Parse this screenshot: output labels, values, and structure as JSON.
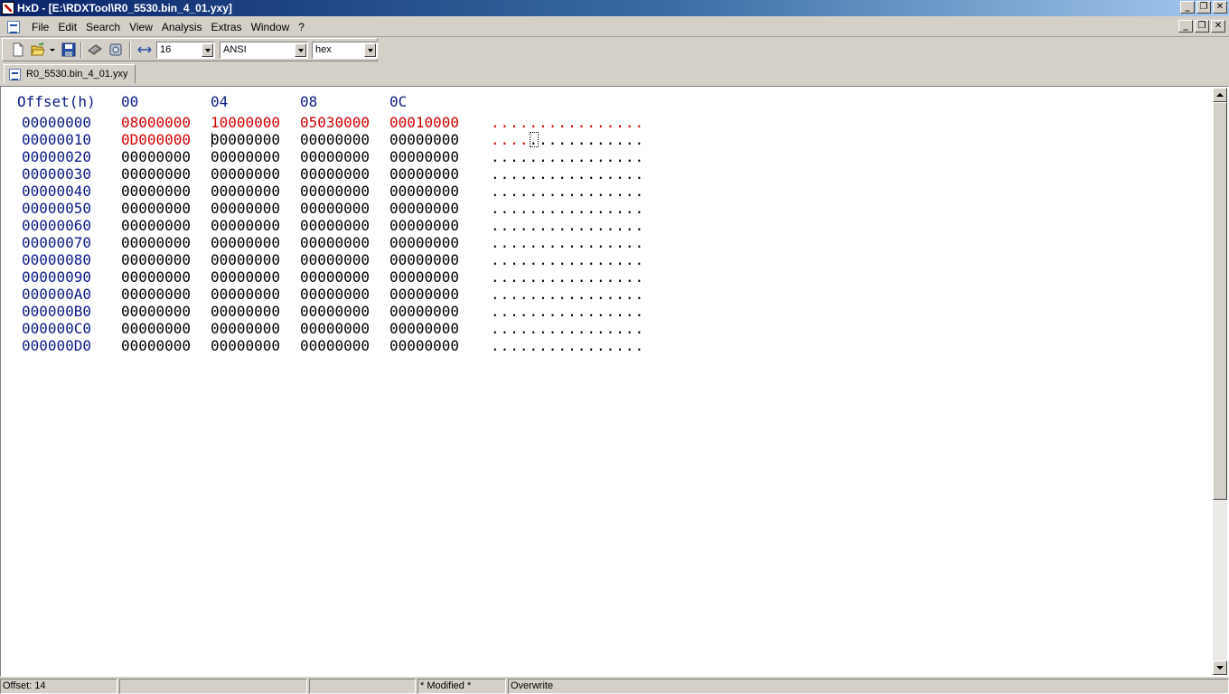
{
  "window": {
    "title": "HxD - [E:\\RDXTool\\R0_5530.bin_4_01.yxy]",
    "buttons": [
      "_",
      "❐",
      "✕"
    ]
  },
  "menu": {
    "items": [
      "File",
      "Edit",
      "Search",
      "View",
      "Analysis",
      "Extras",
      "Window",
      "?"
    ],
    "mdi_buttons": [
      "_",
      "❐",
      "✕"
    ]
  },
  "toolbar": {
    "bytes_per_row": "16",
    "charset": "ANSI",
    "offset_base": "hex"
  },
  "tab": {
    "label": "R0_5530.bin_4_01.yxy"
  },
  "editor": {
    "header": {
      "offset": "Offset(h)",
      "cols": [
        "00",
        "04",
        "08",
        "0C"
      ]
    },
    "rows": [
      {
        "offset": "00000000",
        "groups": [
          "08000000",
          "10000000",
          "05030000",
          "00010000"
        ],
        "ascii": "................"
      },
      {
        "offset": "00000010",
        "groups": [
          "0D000000",
          "00000000",
          "00000000",
          "00000000"
        ],
        "ascii": "................"
      },
      {
        "offset": "00000020",
        "groups": [
          "00000000",
          "00000000",
          "00000000",
          "00000000"
        ],
        "ascii": "................"
      },
      {
        "offset": "00000030",
        "groups": [
          "00000000",
          "00000000",
          "00000000",
          "00000000"
        ],
        "ascii": "................"
      },
      {
        "offset": "00000040",
        "groups": [
          "00000000",
          "00000000",
          "00000000",
          "00000000"
        ],
        "ascii": "................"
      },
      {
        "offset": "00000050",
        "groups": [
          "00000000",
          "00000000",
          "00000000",
          "00000000"
        ],
        "ascii": "................"
      },
      {
        "offset": "00000060",
        "groups": [
          "00000000",
          "00000000",
          "00000000",
          "00000000"
        ],
        "ascii": "................"
      },
      {
        "offset": "00000070",
        "groups": [
          "00000000",
          "00000000",
          "00000000",
          "00000000"
        ],
        "ascii": "................"
      },
      {
        "offset": "00000080",
        "groups": [
          "00000000",
          "00000000",
          "00000000",
          "00000000"
        ],
        "ascii": "................"
      },
      {
        "offset": "00000090",
        "groups": [
          "00000000",
          "00000000",
          "00000000",
          "00000000"
        ],
        "ascii": "................"
      },
      {
        "offset": "000000A0",
        "groups": [
          "00000000",
          "00000000",
          "00000000",
          "00000000"
        ],
        "ascii": "................"
      },
      {
        "offset": "000000B0",
        "groups": [
          "00000000",
          "00000000",
          "00000000",
          "00000000"
        ],
        "ascii": "................"
      },
      {
        "offset": "000000C0",
        "groups": [
          "00000000",
          "00000000",
          "00000000",
          "00000000"
        ],
        "ascii": "................"
      },
      {
        "offset": "000000D0",
        "groups": [
          "00000000",
          "00000000",
          "00000000",
          "00000000"
        ],
        "ascii": "................"
      }
    ],
    "modified_groups": [
      [
        0,
        0
      ],
      [
        0,
        1
      ],
      [
        0,
        2
      ],
      [
        0,
        3
      ],
      [
        1,
        0
      ]
    ],
    "modified_ascii": [
      [
        0,
        16
      ],
      [
        1,
        4
      ]
    ]
  },
  "status": {
    "offset": "Offset: 14",
    "blank1": "",
    "blank2": "",
    "modified": "* Modified *",
    "mode": "Overwrite"
  },
  "colors": {
    "offset_text": "#0b1a88",
    "modified_text": "#d40000",
    "normal_text": "#000000",
    "title_gradient_start": "#0a246a"
  }
}
